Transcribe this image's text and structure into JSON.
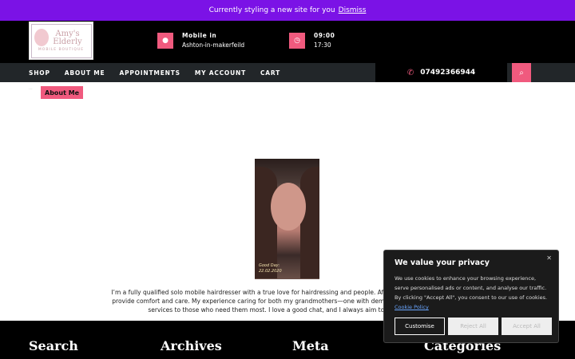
{
  "notice": {
    "text": "Currently styling a new site for you",
    "dismiss": "Dismiss"
  },
  "logo": {
    "name_line1": "Amy's",
    "name_line2": "Elderly",
    "subtitle": "MOBILE BOUTIQUE"
  },
  "header": {
    "location": {
      "title": "Mobile in",
      "value": "Ashton-in-makerfeild"
    },
    "hours": {
      "title": "09:00",
      "value": "17:30"
    }
  },
  "nav": {
    "items": [
      "SHOP",
      "ABOUT ME",
      "APPOINTMENTS",
      "MY ACCOUNT",
      "CART"
    ],
    "phone": "07492366944"
  },
  "page": {
    "breadcrumb": "...",
    "title": "About Me"
  },
  "photo": {
    "caption_line1": "Good Day:",
    "caption_line2": "22.02.2020"
  },
  "content": {
    "line1": "I’m a fully qualified solo mobile hairdresser with a true love for hairdressing and people. After taking time to raise my",
    "line2": "provide comfort and care. My experience caring for both my grandmothers—one with dementia and the other with C",
    "line3": "services to those who need them most. I love a good chat, and I always aim to make you fee"
  },
  "footer": {
    "titles": [
      "Search",
      "Archives",
      "Meta",
      "Categories"
    ]
  },
  "cookie": {
    "title": "We value your privacy",
    "body": "We use cookies to enhance your browsing experience, serve personalised ads or content, and analyse our traffic. By clicking \"Accept All\", you consent to our use of cookies.",
    "policy_link": "Cookie Policy",
    "customise": "Customise",
    "reject": "Reject All",
    "accept": "Accept All"
  },
  "colors": {
    "accent": "#f05a7e",
    "notice_bg": "#7b12e6"
  }
}
